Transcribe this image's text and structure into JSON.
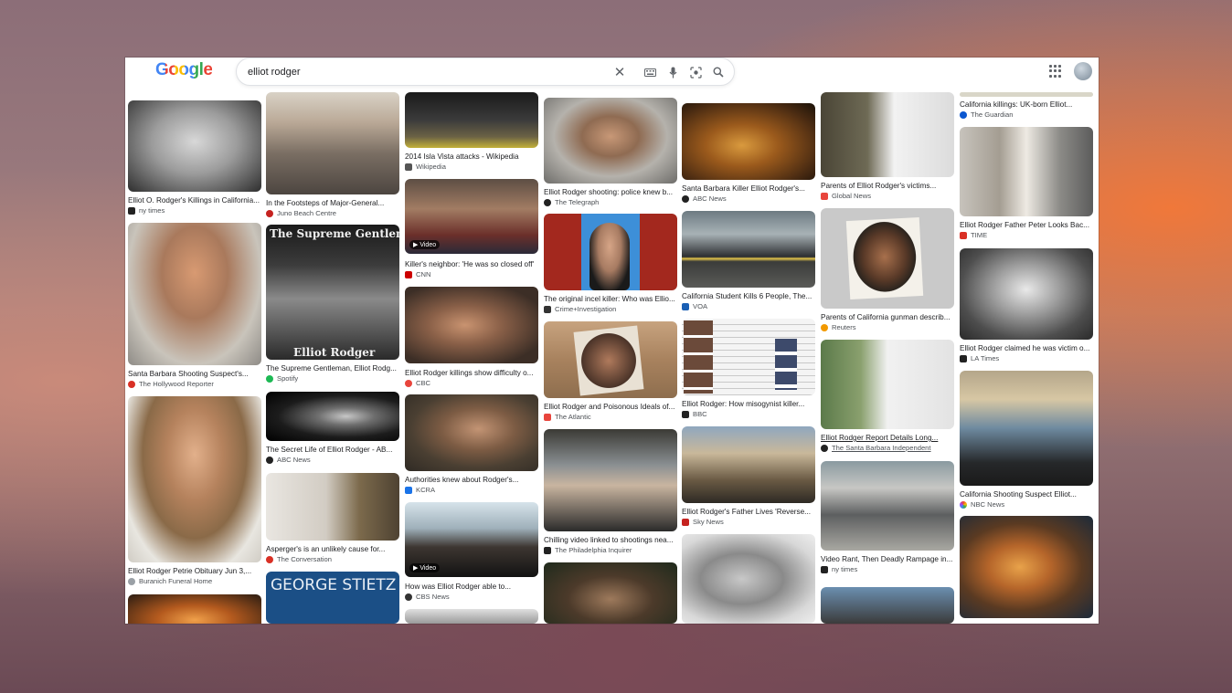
{
  "header": {
    "logo_text": "Google",
    "search_value": "elliot rodger",
    "clear_icon": "close-icon",
    "keyboard_icon": "keyboard-icon",
    "mic_icon": "microphone-icon",
    "lens_icon": "lens-icon",
    "search_icon": "search-icon",
    "apps_icon": "apps-grid-icon"
  },
  "results": [
    {
      "caption": "Elliot O. Rodger's Killings in California...",
      "source": "ny times",
      "color": "#222222"
    },
    {
      "caption": "Santa Barbara Shooting Suspect's...",
      "source": "The Hollywood Reporter",
      "color": "#d93025"
    },
    {
      "caption": "Elliot Rodger Petrie Obituary Jun 3,...",
      "source": "Buranich Funeral Home",
      "color": "#9aa0a6"
    },
    {
      "caption": "In the Footsteps of Major-General...",
      "source": "Juno Beach Centre",
      "color": "#c5221f"
    },
    {
      "caption": "The Supreme Gentleman, Elliot Rodg...",
      "source": "Spotify",
      "color": "#1db954"
    },
    {
      "caption": "The Secret Life of Elliot Rodger - AB...",
      "source": "ABC News",
      "color": "#222222"
    },
    {
      "caption": "Asperger's is an unlikely cause for...",
      "source": "The Conversation",
      "color": "#d93025"
    },
    {
      "caption": "2014 Isla Vista attacks - Wikipedia",
      "source": "Wikipedia",
      "color": "#555555"
    },
    {
      "caption": "Killer's neighbor: 'He was so closed off'",
      "source": "CNN",
      "color": "#cc0000",
      "video": "Video"
    },
    {
      "caption": "Elliot Rodger killings show difficulty o...",
      "source": "CBC",
      "color": "#e8453c"
    },
    {
      "caption": "Authorities knew about Rodger's...",
      "source": "KCRA",
      "color": "#1a73e8"
    },
    {
      "caption": "How was Elliot Rodger able to...",
      "source": "CBS News",
      "color": "#333333",
      "video": "Video"
    },
    {
      "caption": "Elliot Rodger shooting: police knew b...",
      "source": "The Telegraph",
      "color": "#222222"
    },
    {
      "caption": "The original incel killer: Who was Ellio...",
      "source": "Crime+Investigation",
      "color": "#333333"
    },
    {
      "caption": "Elliot Rodger and Poisonous Ideals of...",
      "source": "The Atlantic",
      "color": "#e8453c"
    },
    {
      "caption": "Chilling video linked to shootings nea...",
      "source": "The Philadelphia Inquirer",
      "color": "#222222"
    },
    {
      "caption": "Santa Barbara Killer Elliot Rodger's...",
      "source": "ABC News",
      "color": "#222222"
    },
    {
      "caption": "California Student Kills 6 People, The...",
      "source": "VOA",
      "color": "#1a5fb4"
    },
    {
      "caption": "Elliot Rodger: How misogynist killer...",
      "source": "BBC",
      "color": "#222222"
    },
    {
      "caption": "Elliot Rodger's Father Lives 'Reverse...",
      "source": "Sky News",
      "color": "#c5221f"
    },
    {
      "caption": "Parents of Elliot Rodger's victims...",
      "source": "Global News",
      "color": "#e8453c"
    },
    {
      "caption": "Parents of California gunman describ...",
      "source": "Reuters",
      "color": "#f29900"
    },
    {
      "caption": "Elliot Rodger Report Details Long...",
      "source": "The Santa Barbara Independent",
      "color": "#222222"
    },
    {
      "caption": "Video Rant, Then Deadly Rampage in...",
      "source": "ny times",
      "color": "#222222"
    },
    {
      "caption": "California killings: UK-born Elliot...",
      "source": "The Guardian",
      "color": "#0b57d0"
    },
    {
      "caption": "Elliot Rodger Father Peter Looks Bac...",
      "source": "TIME",
      "color": "#d93025"
    },
    {
      "caption": "Elliot Rodger claimed he was victim o...",
      "source": "LA Times",
      "color": "#222222"
    },
    {
      "caption": "California Shooting Suspect Elliot...",
      "source": "NBC News",
      "color": "#1a73e8"
    }
  ],
  "thumb_texts": {
    "supreme_title": "The Supreme Gentleman",
    "supreme_footer": "Elliot Rodger",
    "george": "GEORGE STIETZ"
  }
}
